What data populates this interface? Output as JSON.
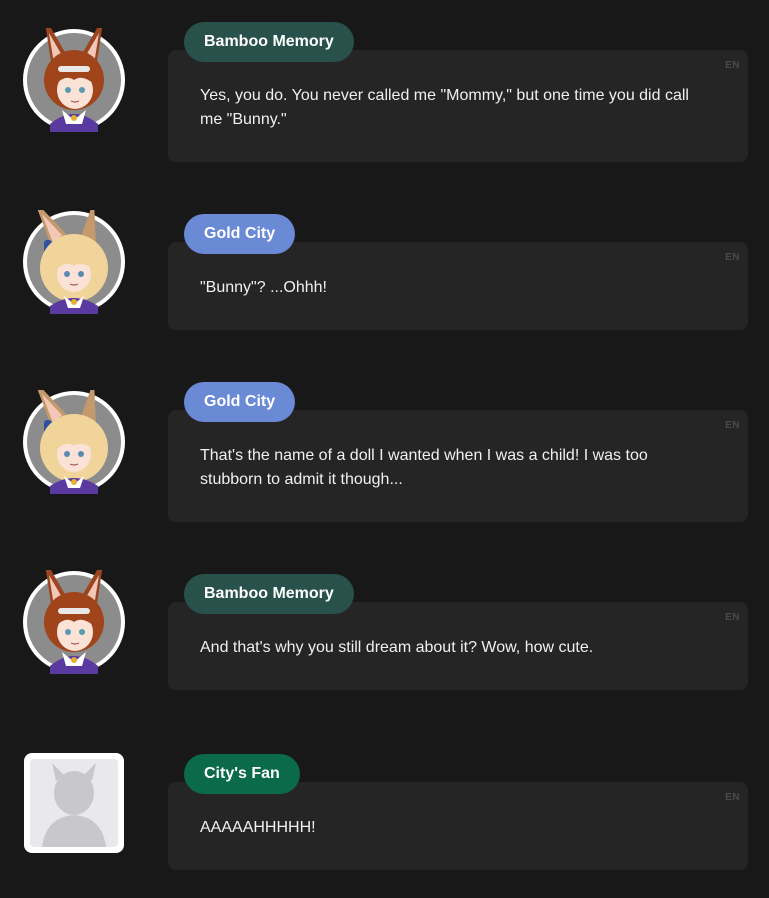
{
  "messages": [
    {
      "speaker": "Bamboo Memory",
      "text": "Yes, you do. You never called me \"Mommy,\" but one time you did call me \"Bunny.\"",
      "lang": "EN",
      "avatar_icon": "bamboo-memory-avatar-icon"
    },
    {
      "speaker": "Gold City",
      "text": "\"Bunny\"? ...Ohhh!",
      "lang": "EN",
      "avatar_icon": "gold-city-avatar-icon"
    },
    {
      "speaker": "Gold City",
      "text": "That's the name of a doll I wanted when I was a child! I was too stubborn to admit it though...",
      "lang": "EN",
      "avatar_icon": "gold-city-avatar-icon"
    },
    {
      "speaker": "Bamboo Memory",
      "text": "And that's why you still dream about it? Wow, how cute.",
      "lang": "EN",
      "avatar_icon": "bamboo-memory-avatar-icon"
    },
    {
      "speaker": "City's Fan",
      "text": "AAAAAHHHHH!",
      "lang": "EN",
      "avatar_icon": "generic-silhouette-avatar-icon"
    }
  ],
  "colors": {
    "background": "#181818",
    "bubble": "#252525",
    "tag_bamboo": "#27514a",
    "tag_gold": "#6b8ad6",
    "tag_fan": "#0b6a4a"
  }
}
